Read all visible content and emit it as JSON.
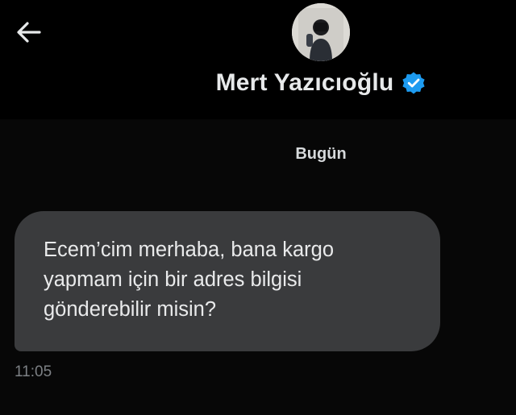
{
  "header": {
    "back_icon": "arrow-left-icon",
    "avatar_icon": "profile-photo",
    "display_name": "Mert Yazıcıoğlu",
    "verified_icon": "verified-badge-icon",
    "verified_color": "#1d9bf0"
  },
  "conversation": {
    "date_divider": "Bugün",
    "messages": [
      {
        "text": "Ecem’cim merhaba, bana kargo\nyapmam için bir adres bilgisi\ngönderebilir misin?",
        "time": "11:05",
        "bubble_color": "#3a3b3d"
      }
    ]
  }
}
